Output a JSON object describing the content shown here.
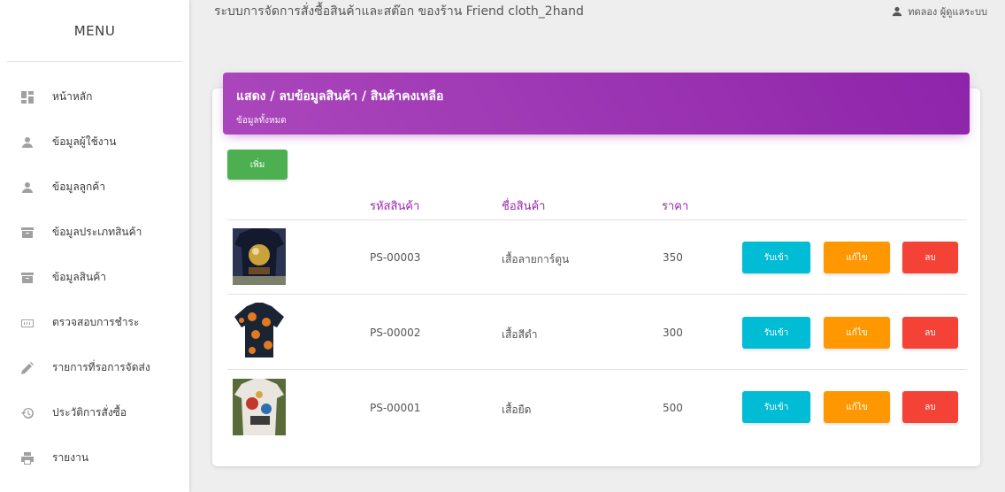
{
  "sidebar": {
    "title": "MENU",
    "items": [
      {
        "label": "หน้าหลัก",
        "icon": "dashboard-icon"
      },
      {
        "label": "ข้อมูลผู้ใช้งาน",
        "icon": "person-icon"
      },
      {
        "label": "ข้อมูลลูกค้า",
        "icon": "person-icon"
      },
      {
        "label": "ข้อมูลประเภทสินค้า",
        "icon": "archive-icon"
      },
      {
        "label": "ข้อมูลสินค้า",
        "icon": "archive-icon"
      },
      {
        "label": "ตรวจสอบการชำระ",
        "icon": "payment-icon"
      },
      {
        "label": "รายการที่รอการจัดส่ง",
        "icon": "pencil-icon"
      },
      {
        "label": "ประวัติการสั่งซื้อ",
        "icon": "history-icon"
      },
      {
        "label": "รายงาน",
        "icon": "print-icon"
      }
    ]
  },
  "topbar": {
    "title": "ระบบการจัดการสั่งซื้อสินค้าและสต๊อก ของร้าน Friend cloth_2hand",
    "user": "ทดลอง ผู้ดูแลระบบ"
  },
  "card": {
    "title": "แสดง / ลบข้อมูลสินค้า / สินค้าคงเหลือ",
    "subtitle": "ข้อมูลทั้งหมด",
    "add_label": "เพิ่ม"
  },
  "table": {
    "headers": [
      "รหัสสินค้า",
      "ชื่อสินค้า",
      "ราคา"
    ],
    "rows": [
      {
        "code": "PS-00003",
        "name": "เสื้อลายการ์ตูน",
        "price": "350"
      },
      {
        "code": "PS-00002",
        "name": "เสื้อสีดำ",
        "price": "300"
      },
      {
        "code": "PS-00001",
        "name": "เสื้อยืด",
        "price": "500"
      }
    ],
    "receive_label": "รับเข้า",
    "edit_label": "แก้ไข",
    "delete_label": "ลบ"
  },
  "colors": {
    "header_gradient_start": "#ab47bc",
    "header_gradient_end": "#8e24aa",
    "add": "#4caf50",
    "receive": "#00bcd4",
    "edit": "#ff9800",
    "delete": "#f44336"
  }
}
